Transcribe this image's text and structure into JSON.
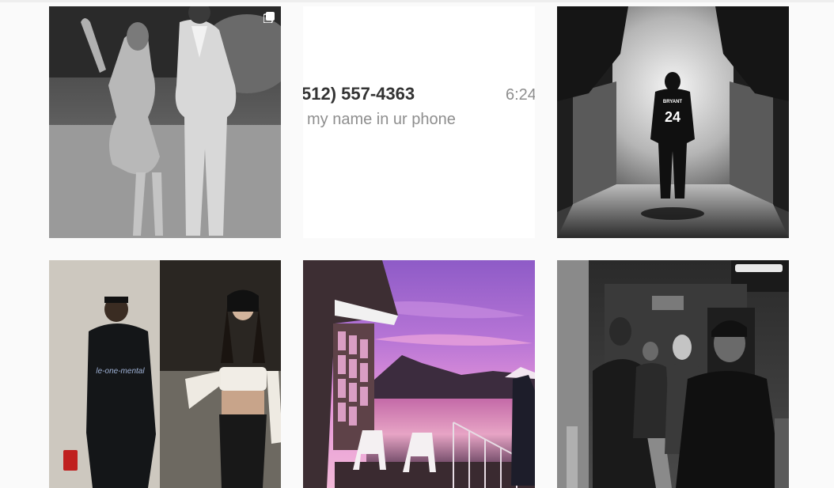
{
  "posts": [
    {
      "id": "post-1",
      "type": "photo-multi",
      "icon": "multiple-photos-icon"
    },
    {
      "id": "post-2",
      "type": "text-screenshot",
      "phone_number": "512) 557-4363",
      "time": "6:24",
      "message": "my name in ur phone"
    },
    {
      "id": "post-3",
      "type": "photo",
      "jersey_name": "BRYANT",
      "jersey_number": "24"
    },
    {
      "id": "post-4",
      "type": "photo",
      "sweatshirt_text": "le-one-mental"
    },
    {
      "id": "post-5",
      "type": "photo"
    },
    {
      "id": "post-6",
      "type": "photo"
    }
  ],
  "colors": {
    "background": "#fafafa",
    "tile_white": "#ffffff",
    "muted_text": "#8e8e8e",
    "sunset_pink": "#e48fd6",
    "sunset_purple": "#a066c8"
  }
}
